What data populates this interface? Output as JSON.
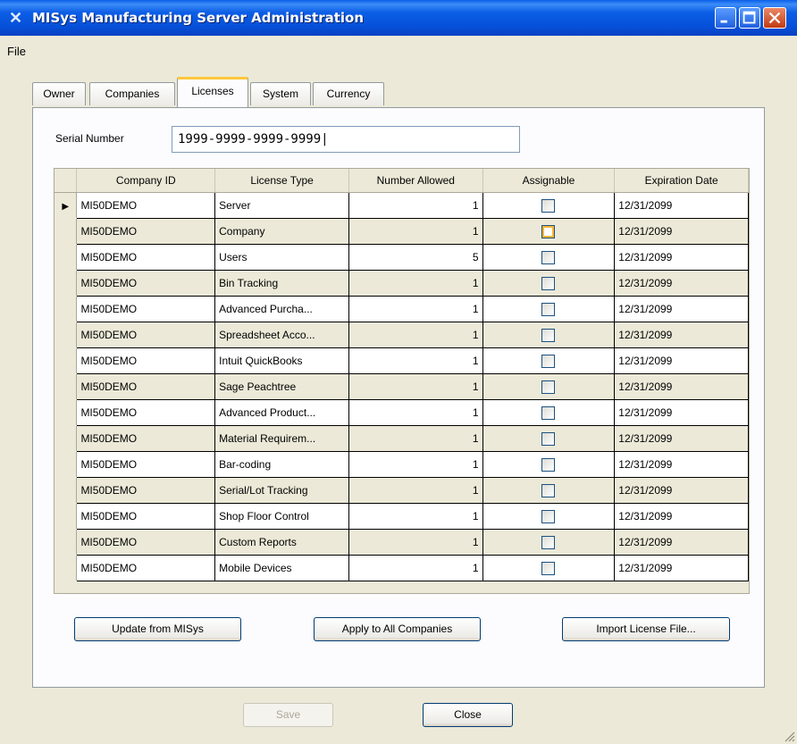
{
  "window": {
    "title": "MISys Manufacturing Server Administration"
  },
  "menu": {
    "file": "File"
  },
  "tabs": [
    "Owner",
    "Companies",
    "Licenses",
    "System",
    "Currency"
  ],
  "serial": {
    "label": "Serial Number",
    "value": "1999-9999-9999-9999"
  },
  "grid": {
    "columns": [
      "Company ID",
      "License Type",
      "Number Allowed",
      "Assignable",
      "Expiration Date"
    ],
    "rows": [
      {
        "company": "MI50DEMO",
        "type": "Server",
        "allowed": "1",
        "assignable": false,
        "expiration": "12/31/2099"
      },
      {
        "company": "MI50DEMO",
        "type": "Company",
        "allowed": "1",
        "assignable": false,
        "expiration": "12/31/2099"
      },
      {
        "company": "MI50DEMO",
        "type": "Users",
        "allowed": "5",
        "assignable": false,
        "expiration": "12/31/2099"
      },
      {
        "company": "MI50DEMO",
        "type": "Bin Tracking",
        "allowed": "1",
        "assignable": false,
        "expiration": "12/31/2099"
      },
      {
        "company": "MI50DEMO",
        "type": "Advanced Purcha...",
        "allowed": "1",
        "assignable": false,
        "expiration": "12/31/2099"
      },
      {
        "company": "MI50DEMO",
        "type": "Spreadsheet Acco...",
        "allowed": "1",
        "assignable": false,
        "expiration": "12/31/2099"
      },
      {
        "company": "MI50DEMO",
        "type": "Intuit QuickBooks",
        "allowed": "1",
        "assignable": false,
        "expiration": "12/31/2099"
      },
      {
        "company": "MI50DEMO",
        "type": "Sage Peachtree",
        "allowed": "1",
        "assignable": false,
        "expiration": "12/31/2099"
      },
      {
        "company": "MI50DEMO",
        "type": "Advanced Product...",
        "allowed": "1",
        "assignable": false,
        "expiration": "12/31/2099"
      },
      {
        "company": "MI50DEMO",
        "type": "Material Requirem...",
        "allowed": "1",
        "assignable": false,
        "expiration": "12/31/2099"
      },
      {
        "company": "MI50DEMO",
        "type": "Bar-coding",
        "allowed": "1",
        "assignable": false,
        "expiration": "12/31/2099"
      },
      {
        "company": "MI50DEMO",
        "type": "Serial/Lot Tracking",
        "allowed": "1",
        "assignable": false,
        "expiration": "12/31/2099"
      },
      {
        "company": "MI50DEMO",
        "type": "Shop Floor Control",
        "allowed": "1",
        "assignable": false,
        "expiration": "12/31/2099"
      },
      {
        "company": "MI50DEMO",
        "type": "Custom Reports",
        "allowed": "1",
        "assignable": false,
        "expiration": "12/31/2099"
      },
      {
        "company": "MI50DEMO",
        "type": "Mobile Devices",
        "allowed": "1",
        "assignable": false,
        "expiration": "12/31/2099"
      }
    ]
  },
  "buttons": {
    "update": "Update from MISys",
    "apply": "Apply to All Companies",
    "import": "Import License File...",
    "save": "Save",
    "close": "Close"
  },
  "colors": {
    "titlebar": "#0A5FE8",
    "face": "#ECE9D8",
    "tab_highlight": "#FFC83C"
  }
}
